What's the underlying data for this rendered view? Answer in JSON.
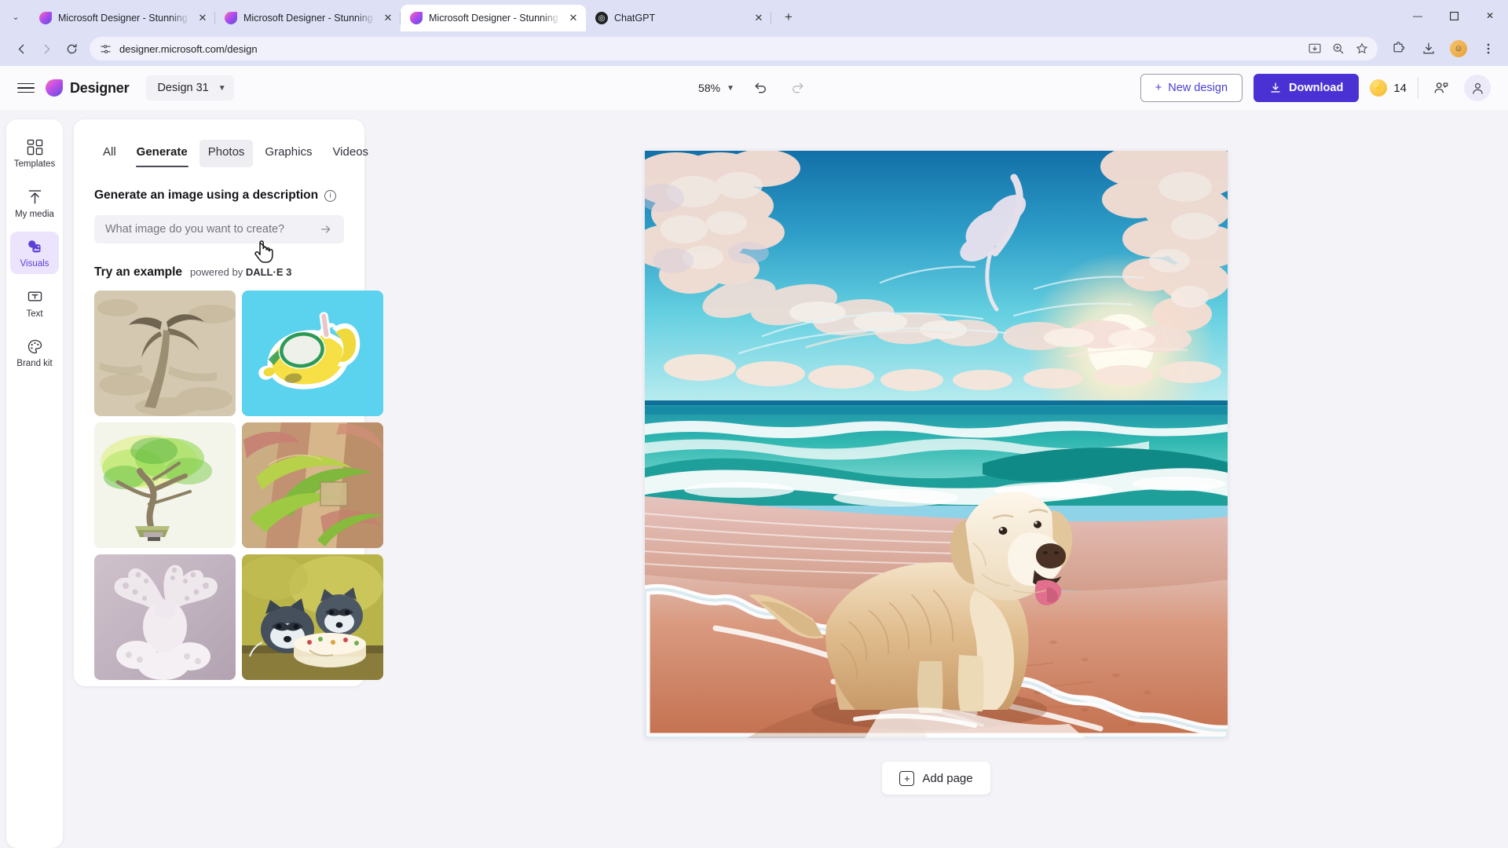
{
  "browser": {
    "tabs": [
      {
        "title": "Microsoft Designer - Stunning ",
        "favicon": "designer-icon",
        "active": false
      },
      {
        "title": "Microsoft Designer - Stunning ",
        "favicon": "designer-icon",
        "active": false
      },
      {
        "title": "Microsoft Designer - Stunning ",
        "favicon": "designer-icon",
        "active": true
      },
      {
        "title": "ChatGPT",
        "favicon": "chatgpt-icon",
        "active": false
      }
    ],
    "tab_close_label": "✕",
    "new_tab_label": "+",
    "tab_search_label": "⌄",
    "window_controls": {
      "minimize": "—",
      "maximize": "☐",
      "close": "✕"
    },
    "nav": {
      "back": "←",
      "forward": "→",
      "reload": "↻"
    },
    "omnibox": {
      "url": "designer.microsoft.com/design",
      "site_settings_icon": "tune-icon",
      "install_icon": "install-app-icon",
      "zoom_icon": "zoom-icon",
      "bookmark_icon": "star-icon"
    },
    "toolbar": {
      "extensions_icon": "extensions-icon",
      "downloads_icon": "download-icon",
      "profile_icon": "profile-avatar",
      "menu_icon": "kebab-menu-icon"
    }
  },
  "app": {
    "brand": "Designer",
    "design_name": "Design 31",
    "zoom_level": "58%",
    "undo_icon": "undo-icon",
    "redo_icon": "redo-icon",
    "new_design_label": "New design",
    "download_label": "Download",
    "credits_count": "14",
    "credits_icon": "lightning-coin-icon",
    "share_icon": "share-people-icon",
    "account_icon": "person-icon"
  },
  "sidebar": {
    "items": [
      {
        "label": "Templates",
        "icon": "templates-grid-icon",
        "active": false
      },
      {
        "label": "My media",
        "icon": "upload-arrow-icon",
        "active": false
      },
      {
        "label": "Visuals",
        "icon": "visuals-photos-icon",
        "active": true
      },
      {
        "label": "Text",
        "icon": "text-box-icon",
        "active": false
      },
      {
        "label": "Brand kit",
        "icon": "palette-icon",
        "active": false
      }
    ]
  },
  "panel": {
    "tabs": [
      {
        "label": "All",
        "state": "normal"
      },
      {
        "label": "Generate",
        "state": "active"
      },
      {
        "label": "Photos",
        "state": "hover"
      },
      {
        "label": "Graphics",
        "state": "normal"
      },
      {
        "label": "Videos",
        "state": "normal"
      }
    ],
    "generate_heading": "Generate an image using a description",
    "info_icon": "info-icon",
    "prompt_placeholder": "What image do you want to create?",
    "prompt_value": "",
    "prompt_submit_icon": "arrow-right-icon",
    "example_title": "Try an example",
    "example_sub_prefix": "powered by ",
    "example_sub_brand": "DALL·E 3",
    "examples": [
      {
        "name": "sand-palm-tree-sculpture"
      },
      {
        "name": "snorkeling-yellow-fish-sticker"
      },
      {
        "name": "watercolor-bonsai-tree"
      },
      {
        "name": "leaf-collage-house"
      },
      {
        "name": "white-octopus-sculpture"
      },
      {
        "name": "raccoons-eating-cake-painting"
      }
    ]
  },
  "canvas": {
    "artwork_name": "golden-retriever-on-beach-at-sunset",
    "add_page_label": "Add page",
    "add_page_icon": "plus-square-icon"
  }
}
